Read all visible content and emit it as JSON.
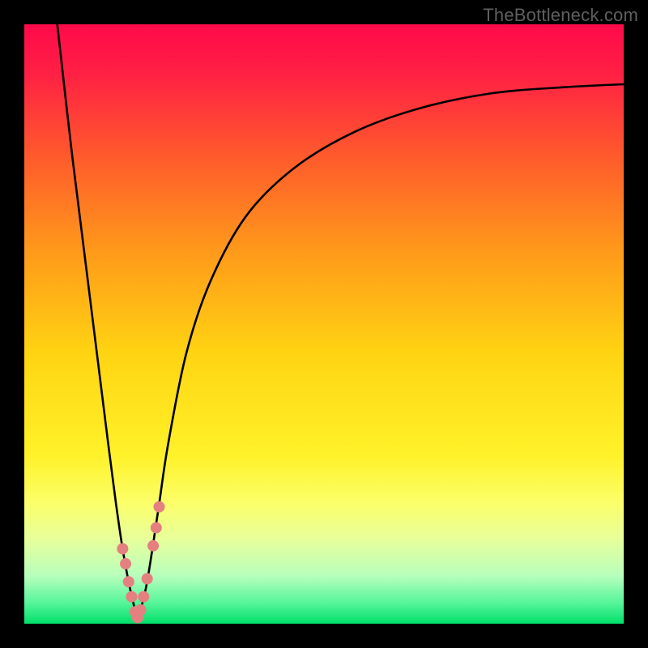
{
  "watermark": "TheBottleneck.com",
  "chart_data": {
    "type": "line",
    "title": "",
    "xlabel": "",
    "ylabel": "",
    "xlim": [
      0,
      100
    ],
    "ylim": [
      0,
      100
    ],
    "gradient_stops": [
      {
        "offset": 0,
        "color": "#ff0a4a"
      },
      {
        "offset": 0.08,
        "color": "#ff1f44"
      },
      {
        "offset": 0.22,
        "color": "#ff5a2c"
      },
      {
        "offset": 0.38,
        "color": "#ff9a1a"
      },
      {
        "offset": 0.55,
        "color": "#ffd412"
      },
      {
        "offset": 0.72,
        "color": "#fff22a"
      },
      {
        "offset": 0.8,
        "color": "#fbff6a"
      },
      {
        "offset": 0.86,
        "color": "#e7ff9c"
      },
      {
        "offset": 0.92,
        "color": "#b7ffbc"
      },
      {
        "offset": 0.965,
        "color": "#57f59a"
      },
      {
        "offset": 1.0,
        "color": "#00e06a"
      }
    ],
    "series": [
      {
        "name": "bottleneck-curve",
        "x": [
          5.5,
          8.0,
          10.5,
          12.5,
          14.0,
          15.3,
          16.4,
          17.4,
          18.3,
          18.8,
          19.3,
          20.3,
          21.3,
          22.5,
          24.0,
          27.0,
          31.0,
          37.0,
          45.0,
          55.0,
          66.0,
          78.0,
          90.0,
          100.0
        ],
        "y": [
          100.0,
          78.0,
          58.0,
          42.0,
          30.0,
          20.0,
          12.5,
          7.0,
          3.0,
          1.0,
          2.0,
          6.0,
          12.0,
          20.0,
          30.0,
          45.0,
          57.0,
          68.0,
          76.0,
          82.0,
          86.0,
          88.5,
          89.5,
          90.0
        ]
      }
    ],
    "markers": {
      "color": "#e58080",
      "radius_px": 7,
      "points": [
        {
          "x": 16.4,
          "y": 12.5
        },
        {
          "x": 16.9,
          "y": 10.0
        },
        {
          "x": 17.4,
          "y": 7.0
        },
        {
          "x": 17.9,
          "y": 4.5
        },
        {
          "x": 18.5,
          "y": 2.0
        },
        {
          "x": 18.9,
          "y": 1.0
        },
        {
          "x": 19.4,
          "y": 2.3
        },
        {
          "x": 19.9,
          "y": 4.5
        },
        {
          "x": 20.5,
          "y": 7.5
        },
        {
          "x": 21.5,
          "y": 13.0
        },
        {
          "x": 22.0,
          "y": 16.0
        },
        {
          "x": 22.5,
          "y": 19.5
        }
      ]
    }
  }
}
